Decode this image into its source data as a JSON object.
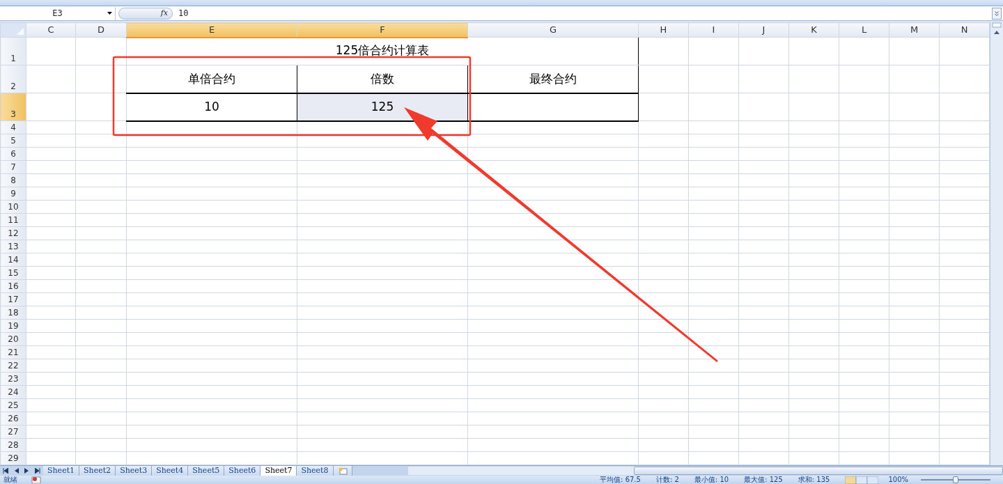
{
  "name_box": "E3",
  "function_label": "fx",
  "formula": "10",
  "columns": [
    {
      "label": "C",
      "selected": false
    },
    {
      "label": "D",
      "selected": false
    },
    {
      "label": "E",
      "selected": true
    },
    {
      "label": "F",
      "selected": true
    },
    {
      "label": "G",
      "selected": false
    },
    {
      "label": "H",
      "selected": false
    },
    {
      "label": "I",
      "selected": false
    },
    {
      "label": "J",
      "selected": false
    },
    {
      "label": "K",
      "selected": false
    },
    {
      "label": "L",
      "selected": false
    },
    {
      "label": "M",
      "selected": false
    },
    {
      "label": "N",
      "selected": false
    }
  ],
  "rows": [
    {
      "label": "1",
      "selected": false
    },
    {
      "label": "2",
      "selected": false
    },
    {
      "label": "3",
      "selected": true
    },
    {
      "label": "4",
      "selected": false
    },
    {
      "label": "5",
      "selected": false
    },
    {
      "label": "6",
      "selected": false
    },
    {
      "label": "7",
      "selected": false
    },
    {
      "label": "8",
      "selected": false
    },
    {
      "label": "9",
      "selected": false
    },
    {
      "label": "10",
      "selected": false
    },
    {
      "label": "11",
      "selected": false
    },
    {
      "label": "12",
      "selected": false
    },
    {
      "label": "13",
      "selected": false
    },
    {
      "label": "14",
      "selected": false
    },
    {
      "label": "15",
      "selected": false
    },
    {
      "label": "16",
      "selected": false
    },
    {
      "label": "17",
      "selected": false
    },
    {
      "label": "18",
      "selected": false
    },
    {
      "label": "19",
      "selected": false
    },
    {
      "label": "20",
      "selected": false
    },
    {
      "label": "21",
      "selected": false
    },
    {
      "label": "22",
      "selected": false
    },
    {
      "label": "23",
      "selected": false
    },
    {
      "label": "24",
      "selected": false
    },
    {
      "label": "25",
      "selected": false
    },
    {
      "label": "26",
      "selected": false
    },
    {
      "label": "27",
      "selected": false
    },
    {
      "label": "28",
      "selected": false
    },
    {
      "label": "29",
      "selected": false
    }
  ],
  "table": {
    "title": "125倍合约计算表",
    "headers": [
      "单倍合约",
      "倍数",
      "最终合约"
    ],
    "values": [
      {
        "text": "10",
        "selected": false
      },
      {
        "text": "125",
        "selected": true
      },
      {
        "selected": false
      }
    ]
  },
  "sheet_tabs": [
    {
      "label": "Sheet1",
      "selected": false
    },
    {
      "label": "Sheet2",
      "selected": false
    },
    {
      "label": "Sheet3",
      "selected": false
    },
    {
      "label": "Sheet4",
      "selected": false
    },
    {
      "label": "Sheet5",
      "selected": false
    },
    {
      "label": "Sheet6",
      "selected": false
    },
    {
      "label": "Sheet7",
      "selected": true
    },
    {
      "label": "Sheet8",
      "selected": false
    }
  ],
  "status_bar": {
    "mode": "就绪",
    "stats": [
      "平均值: 67.5",
      "计数: 2",
      "最小值: 10",
      "最大值: 125",
      "求和: 135"
    ],
    "zoom": "100%",
    "zoom_slider": {
      "level": 0.5
    }
  }
}
